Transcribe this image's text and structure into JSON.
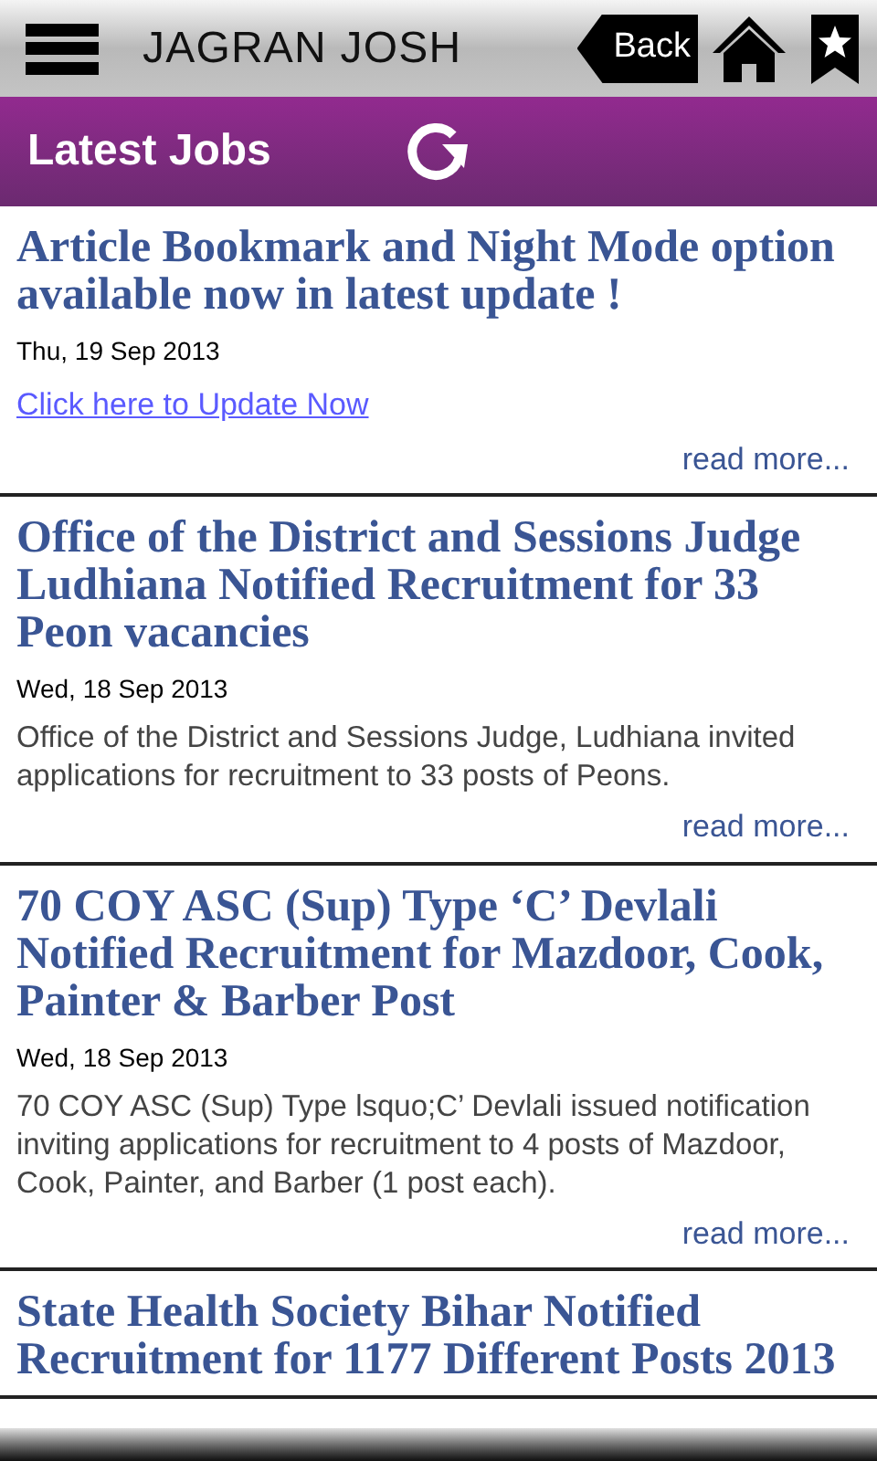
{
  "header": {
    "title": "JAGRAN JOSH",
    "back_label": "Back"
  },
  "section": {
    "title": "Latest Jobs"
  },
  "articles": [
    {
      "title": "Article Bookmark and Night Mode option available now in latest update !",
      "date": "Thu, 19 Sep 2013",
      "link": "Click here to Update Now",
      "read_more": "read more..."
    },
    {
      "title": "Office of the District and Sessions Judge Ludhiana Notified Recruitment for 33 Peon vacancies",
      "date": "Wed, 18 Sep 2013",
      "summary": "Office of the District and Sessions Judge, Ludhiana invited applications for recruitment to 33 posts of Peons.",
      "read_more": "read more..."
    },
    {
      "title": "70 COY ASC (Sup) Type ‘C’ Devlali Notified Recruitment for Mazdoor, Cook, Painter & Barber Post",
      "date": "Wed, 18 Sep 2013",
      "summary": "70 COY ASC (Sup) Type lsquo;C’ Devlali issued notification inviting applications for recruitment to 4 posts of Mazdoor, Cook, Painter, and Barber (1 post each).",
      "read_more": "read more..."
    },
    {
      "title": "State Health Society Bihar Notified Recruitment for 1177 Different Posts 2013"
    }
  ]
}
